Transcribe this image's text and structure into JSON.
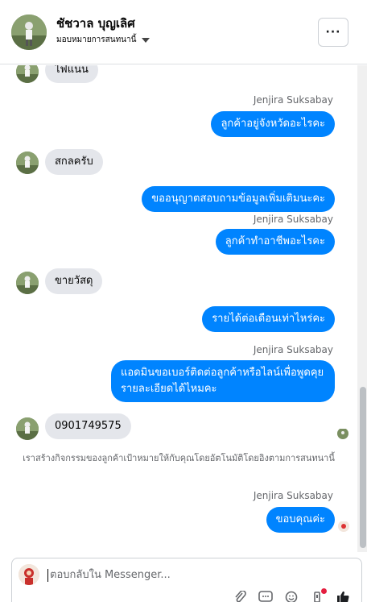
{
  "header": {
    "name": "ชัชวาล บุญเลิศ",
    "assign_label": "มอบหมายการสนทนานี้",
    "more_label": "···"
  },
  "messages": [
    {
      "side": "in",
      "text": "ไฟแนน"
    },
    {
      "side": "out",
      "sender": "Jenjira Suksabay",
      "text": "ลูกค้าอยู่จังหวัดอะไรคะ"
    },
    {
      "side": "in",
      "text": "สกลครับ"
    },
    {
      "side": "out",
      "text": "ขออนุญาตสอบถามข้อมูลเพิ่มเติมนะคะ"
    },
    {
      "side": "out",
      "sender": "Jenjira Suksabay",
      "text": "ลูกค้าทำอาชีพอะไรคะ"
    },
    {
      "side": "in",
      "text": "ขายวัสดุ"
    },
    {
      "side": "out",
      "text": "รายได้ต่อเดือนเท่าไหร่คะ"
    },
    {
      "side": "out",
      "sender": "Jenjira Suksabay",
      "text": "แอดมินขอเบอร์ติดต่อลูกค้าหรือไลน์เพื่อพูดคุยรายละเอียดได้ไหมคะ"
    },
    {
      "side": "in",
      "text": "0901749575"
    },
    {
      "side": "system",
      "text": "เราสร้างกิจกรรมของลูกค้าเป้าหมายให้กับคุณโดยอัตโนมัติโดยอิงตามการสนทนานี้"
    },
    {
      "side": "out",
      "sender": "Jenjira Suksabay",
      "text": "ขอบคุณค่ะ"
    }
  ],
  "composer": {
    "placeholder": "ตอบกลับใน Messenger..."
  },
  "tool_icons": [
    "attach-icon",
    "saved-replies-icon",
    "emoji-icon",
    "automation-icon",
    "like-icon"
  ],
  "colors": {
    "outgoing_bubble": "#0084ff",
    "incoming_bubble": "#e4e6eb",
    "notification_dot": "#e41e3f"
  }
}
